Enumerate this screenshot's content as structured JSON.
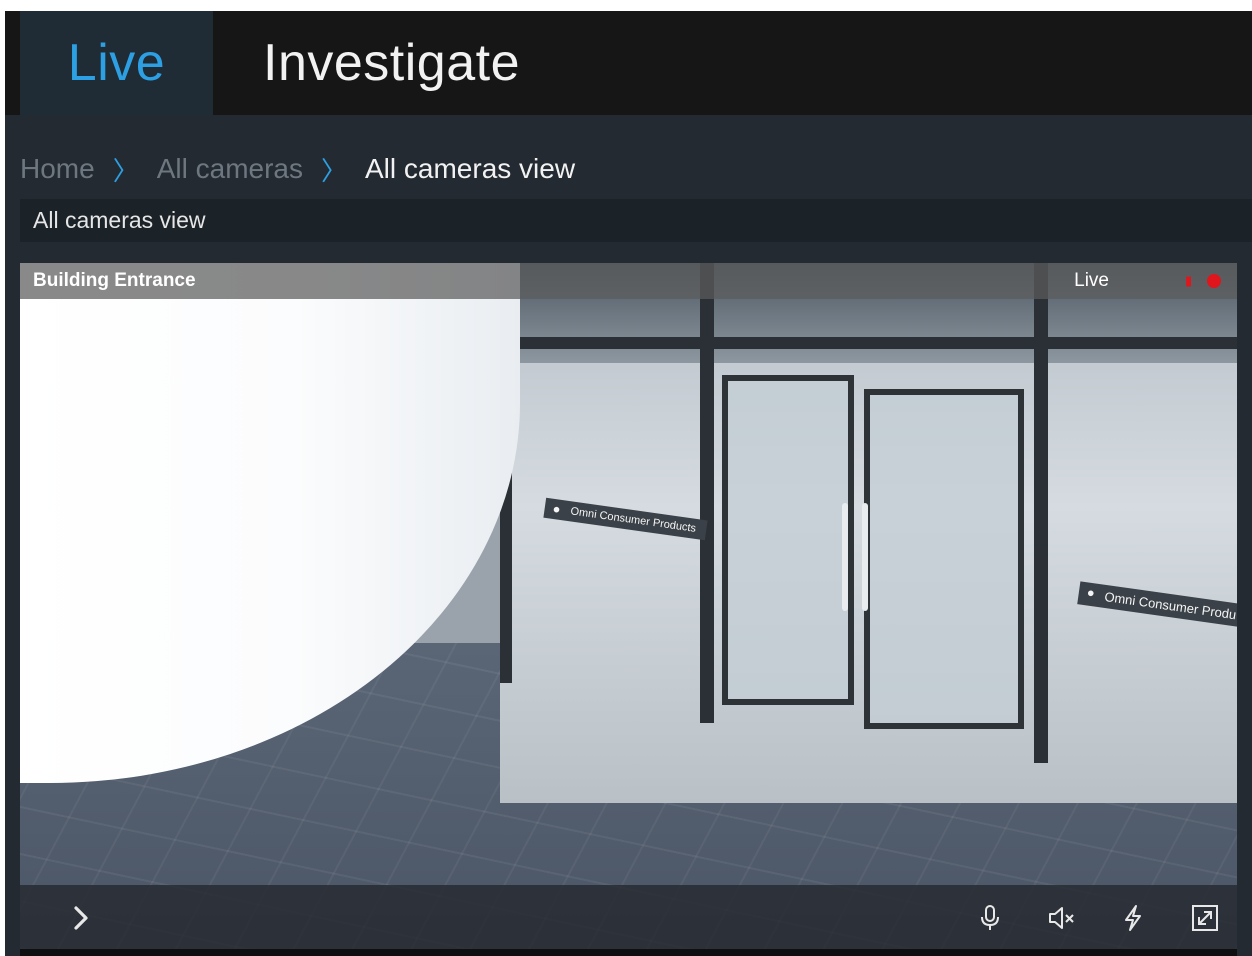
{
  "nav": {
    "tabs": [
      {
        "label": "Live",
        "active": true
      },
      {
        "label": "Investigate",
        "active": false
      }
    ]
  },
  "breadcrumb": {
    "items": [
      "Home",
      "All cameras",
      "All cameras view"
    ],
    "separator": "〉"
  },
  "view": {
    "title": "All cameras view"
  },
  "camera": {
    "name": "Building Entrance",
    "status": "Live",
    "recording": true,
    "signage": [
      "Omni Consumer Products",
      "Omni Consumer Produ"
    ]
  },
  "controls": [
    {
      "name": "expand-panel",
      "icon": "chevron-right-icon"
    },
    {
      "name": "microphone",
      "icon": "microphone-icon"
    },
    {
      "name": "mute",
      "icon": "speaker-muted-icon"
    },
    {
      "name": "trigger-action",
      "icon": "lightning-icon"
    },
    {
      "name": "fullscreen",
      "icon": "expand-icon"
    }
  ],
  "colors": {
    "accent": "#2d9fe3",
    "recording": "#e0161c",
    "background": "#232a31",
    "topbar": "#161616"
  }
}
